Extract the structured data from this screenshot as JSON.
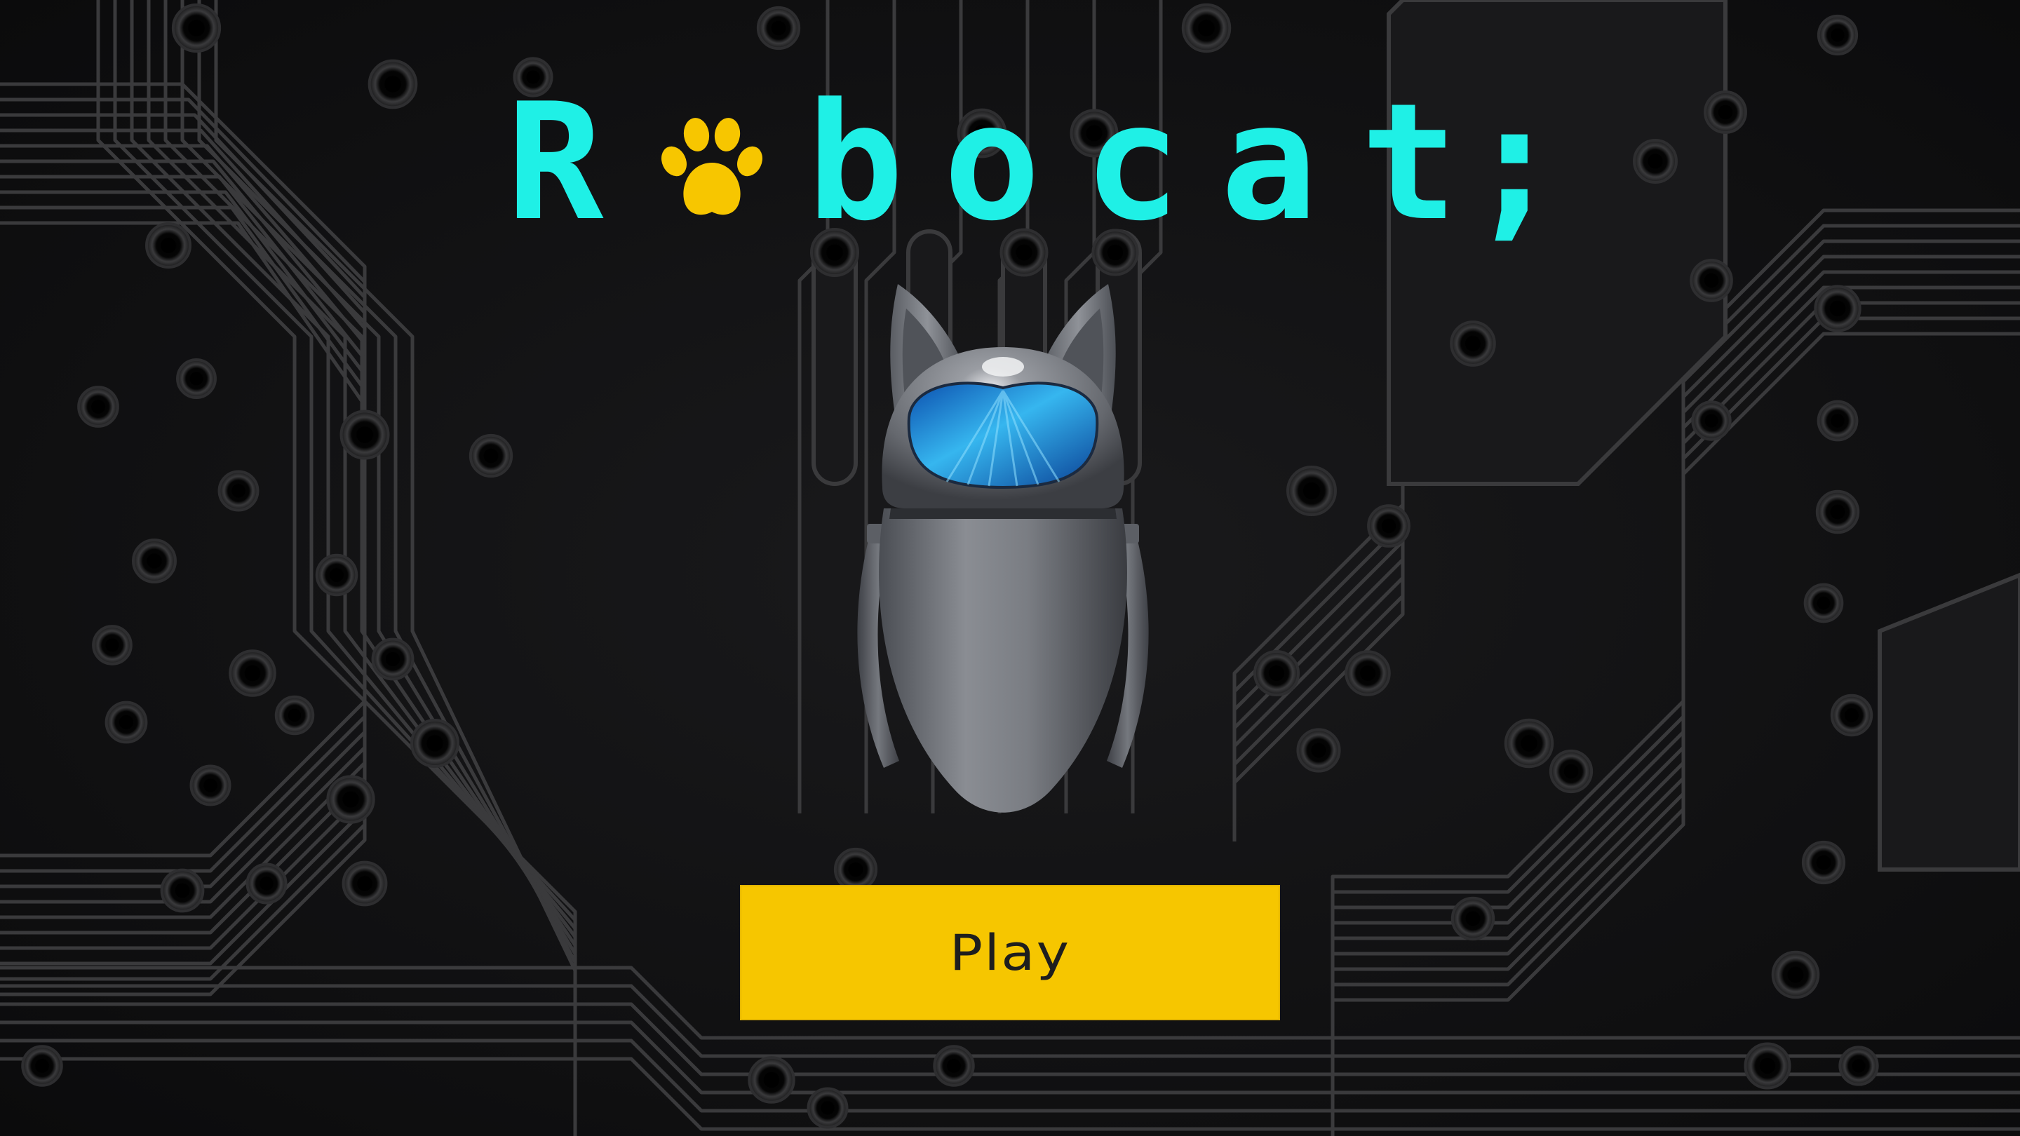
{
  "title": {
    "letters": [
      "R",
      "b",
      "o",
      "c",
      "a",
      "t",
      ";"
    ],
    "color": "#1ff0e6",
    "o_replacement_icon": "paw-icon",
    "paw_color": "#f7c600"
  },
  "menu": {
    "play_label": "Play",
    "button_color": "#f6c600"
  },
  "background": {
    "theme": "circuit-board",
    "base_color": "#111113",
    "trace_color": "#3a3a3c"
  },
  "character": {
    "name_icon": "robot-cat-icon",
    "visor_color": "#2aa8e8"
  }
}
